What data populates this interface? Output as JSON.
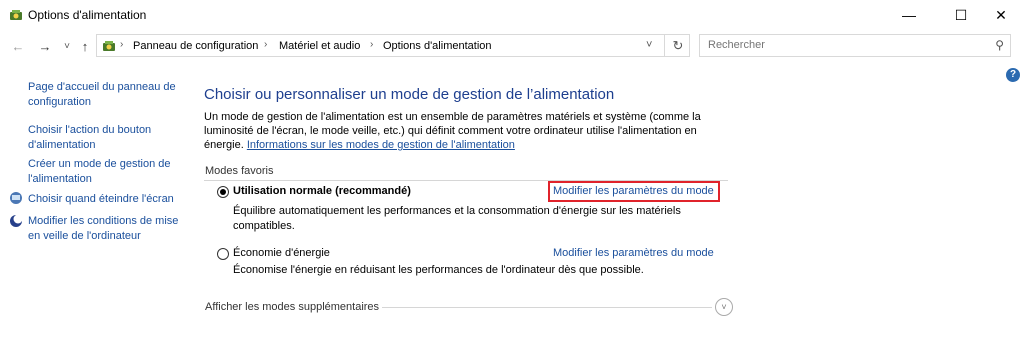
{
  "window": {
    "title": "Options d'alimentation",
    "minimize": "—",
    "maximize": "☐",
    "close": "✕"
  },
  "nav": {
    "back": "←",
    "forward": "→",
    "recent": "˅",
    "up": "↑"
  },
  "breadcrumb": {
    "items": [
      "Panneau de configuration",
      "Matériel et audio",
      "Options d'alimentation"
    ],
    "separator": "›",
    "dropdown": "˅",
    "refresh": "↻"
  },
  "search": {
    "placeholder": "Rechercher",
    "icon": "⚲"
  },
  "help": {
    "label": "?"
  },
  "sidebar": {
    "home_link": "Page d'accueil du panneau de configuration",
    "items": [
      "Choisir l'action du bouton d'alimentation",
      "Créer un mode de gestion de l'alimentation",
      "Choisir quand éteindre l'écran",
      "Modifier les conditions de mise en veille de l'ordinateur"
    ]
  },
  "main": {
    "title": "Choisir ou personnaliser un mode de gestion de l’alimentation",
    "description": "Un mode de gestion de l'alimentation est un ensemble de paramètres matériels et système (comme la luminosité de l'écran, le mode veille, etc.) qui définit comment votre ordinateur utilise l'alimentation en énergie.",
    "info_link": "Informations sur les modes de gestion de l'alimentation",
    "favorites_label": "Modes favoris",
    "plans": [
      {
        "name": "Utilisation normale (recommandé)",
        "selected": true,
        "link": "Modifier les paramètres du mode",
        "description": "Équilibre automatiquement les performances et la consommation d'énergie sur les matériels compatibles."
      },
      {
        "name": "Économie d'énergie",
        "selected": false,
        "link": "Modifier les paramètres du mode",
        "description": "Économise l'énergie en réduisant les performances de l'ordinateur dès que possible."
      }
    ],
    "more_plans": "Afficher les modes supplémentaires",
    "expand_icon": "˅"
  },
  "colors": {
    "accent_link": "#1a4f9c",
    "title_blue": "#1e3f8f",
    "highlight_red": "#e0232b"
  }
}
